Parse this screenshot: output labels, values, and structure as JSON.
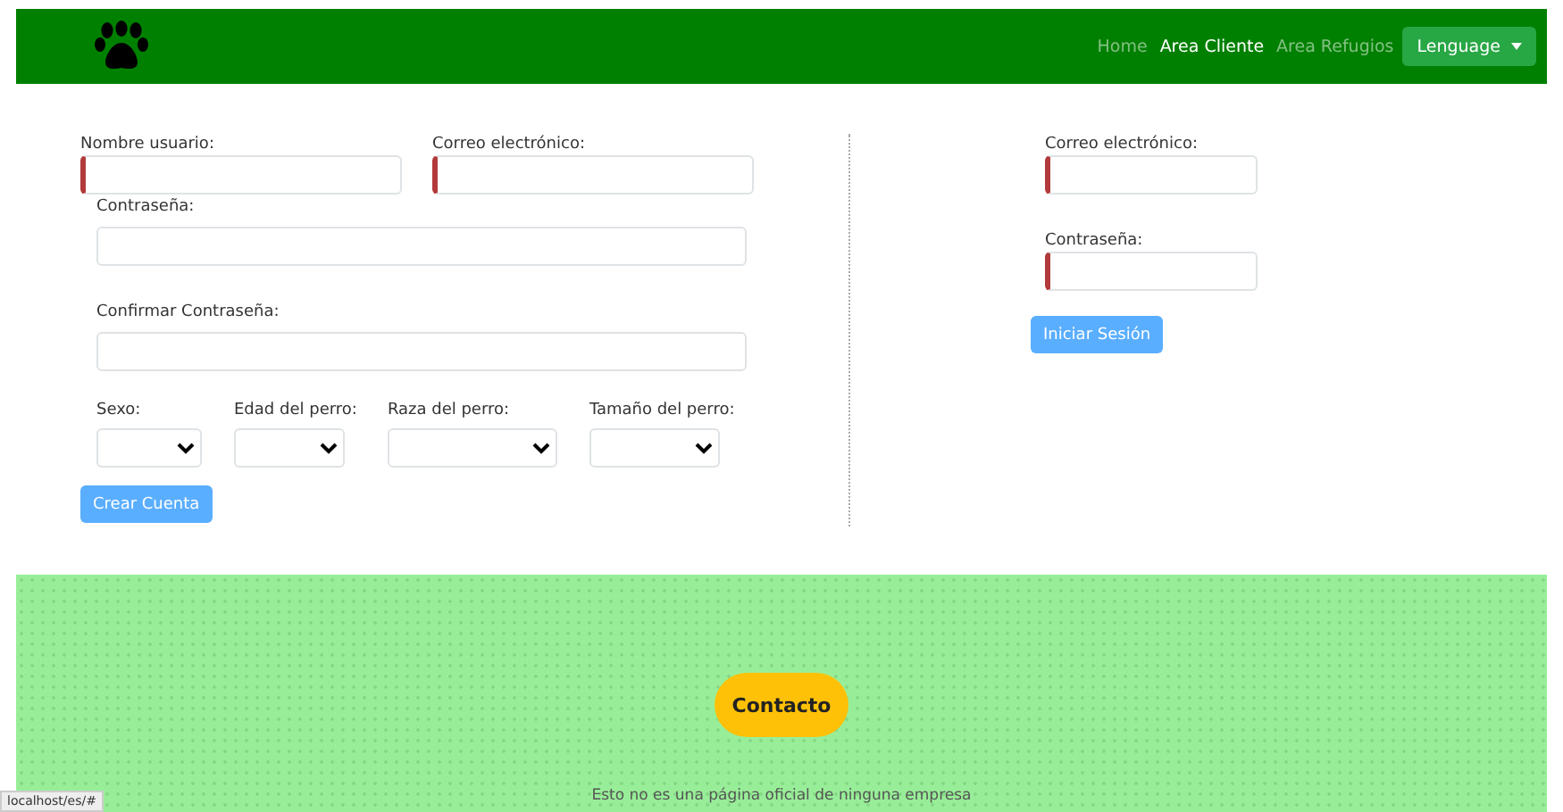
{
  "navbar": {
    "links": [
      {
        "label": "Home",
        "selected": false
      },
      {
        "label": "Area Cliente",
        "selected": true
      },
      {
        "label": "Area Refugios",
        "selected": false
      }
    ],
    "language_button": {
      "label": "Lenguage"
    }
  },
  "register_form": {
    "fields": [
      {
        "label": "Nombre usuario:",
        "invalid": true
      },
      {
        "label": "Correo electrónico:",
        "invalid": true
      },
      {
        "label": "Contraseña:",
        "invalid": false
      },
      {
        "label": "Confirmar Contraseña:",
        "invalid": false
      }
    ],
    "selects": [
      {
        "label": "Sexo:"
      },
      {
        "label": "Edad del perro:"
      },
      {
        "label": "Raza del perro:"
      },
      {
        "label": "Tamaño del perro:"
      }
    ],
    "button": "Crear Cuenta"
  },
  "login_form": {
    "fields": [
      {
        "label": "Correo electrónico:",
        "invalid": true
      },
      {
        "label": "Contraseña:",
        "invalid": true
      }
    ],
    "button": "Iniciar Sesión"
  },
  "footer": {
    "contact_button": "Contacto",
    "note": "Esto no es una página oficial de ninguna empresa"
  },
  "status_bar": {
    "url": "localhost/es/#"
  }
}
